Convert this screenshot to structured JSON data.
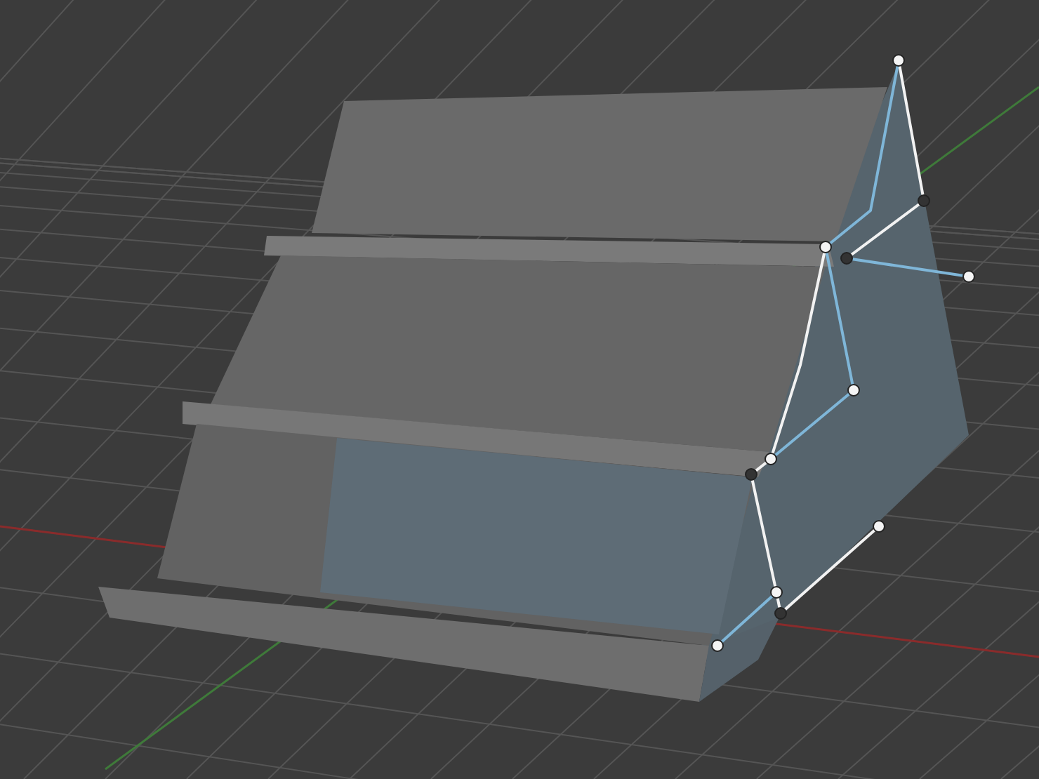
{
  "viewport": {
    "grid": true,
    "axes": true,
    "selection_curve": true
  }
}
